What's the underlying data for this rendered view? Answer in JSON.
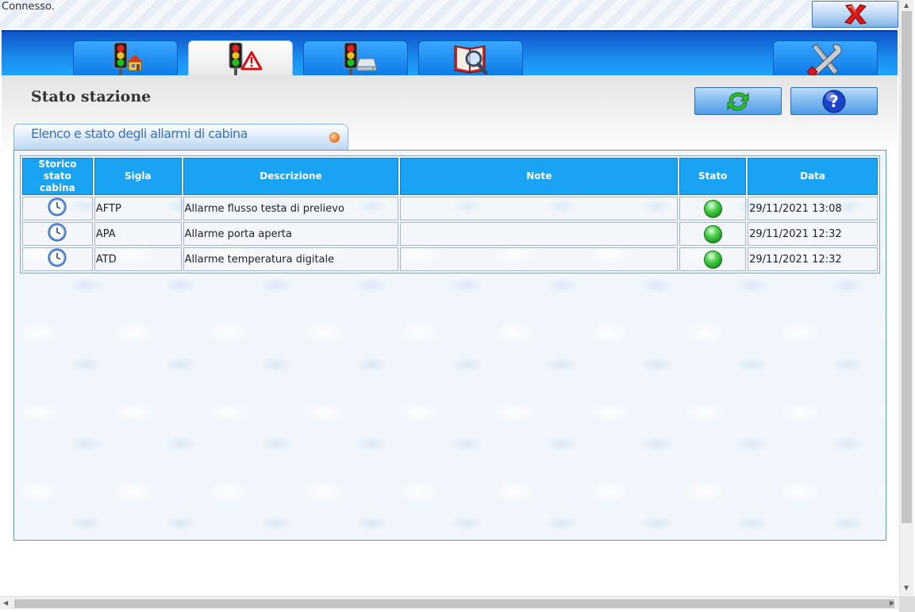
{
  "status_text": "Connesso.",
  "window": {
    "close_icon": "close-x-icon"
  },
  "tabs": [
    {
      "icon": "traffic-light-home-icon",
      "active": false
    },
    {
      "icon": "traffic-light-alarm-icon",
      "active": true
    },
    {
      "icon": "traffic-light-drive-icon",
      "active": false
    },
    {
      "icon": "book-search-icon",
      "active": false
    }
  ],
  "settings_tab": {
    "icon": "tools-icon"
  },
  "page_title": "Stato stazione",
  "toolbar": {
    "refresh_icon": "refresh-icon",
    "help_icon": "help-icon"
  },
  "section": {
    "title": "Elenco e stato degli allarmi di cabina"
  },
  "table": {
    "headers": [
      "Storico stato cabina",
      "Sigla",
      "Descrizione",
      "Note",
      "Stato",
      "Data"
    ],
    "rows": [
      {
        "history_icon": "clock-icon",
        "sigla": "AFTP",
        "descrizione": "Allarme flusso testa di prelievo",
        "note": "",
        "stato": "green",
        "data": "29/11/2021 13:08"
      },
      {
        "history_icon": "clock-icon",
        "sigla": "APA",
        "descrizione": "Allarme porta aperta",
        "note": "",
        "stato": "green",
        "data": "29/11/2021 12:32"
      },
      {
        "history_icon": "clock-icon",
        "sigla": "ATD",
        "descrizione": "Allarme temperatura digitale",
        "note": "",
        "stato": "green",
        "data": "29/11/2021 12:32"
      }
    ]
  },
  "colors": {
    "tab_band": "#1a8cf0",
    "header_bg": "#1aa3f3",
    "status_green": "#54d354"
  }
}
